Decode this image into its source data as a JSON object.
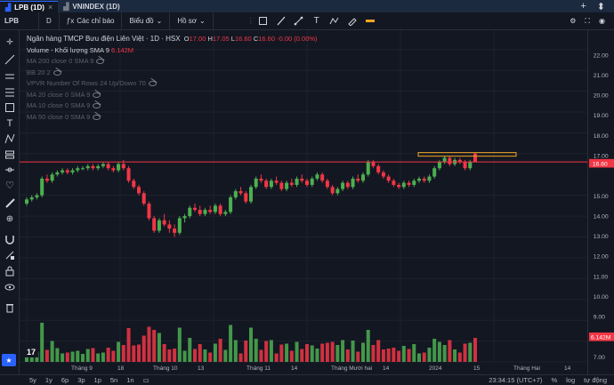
{
  "window_tabs": [
    {
      "label": "LPB (1D)",
      "active": true
    },
    {
      "label": "VNINDEX (1D)",
      "active": false
    }
  ],
  "toolbar": {
    "symbol": "LPB",
    "interval": "D",
    "indicators_label": "Các chỉ báo",
    "chart_type_label": "Biểu đồ",
    "profile_label": "Hồ sơ"
  },
  "legend": {
    "title": "Ngân hàng TMCP Bưu điện Liên Việt · 1D · HSX",
    "ohlc": [
      {
        "k": "O",
        "v": "17.00"
      },
      {
        "k": "H",
        "v": "17.05"
      },
      {
        "k": "L",
        "v": "16.60"
      },
      {
        "k": "C",
        "v": "16.60 -0.00 (0.00%)"
      }
    ],
    "volume_label": "Volume - Khối lượng SMA 9",
    "volume_value": "6.142M",
    "indicators": [
      "MA 200 close 0 SMA 9",
      "BB 20 2",
      "VPVR Number Of Rows 24 Up/Down 70",
      "MA 20 close 0 SMA 9",
      "MA 10 close 0 SMA 9",
      "MA 50 close 0 SMA 9"
    ]
  },
  "price_axis": {
    "ticks": [
      "22.00",
      "21.00",
      "20.00",
      "19.00",
      "18.00",
      "17.00",
      "15.00",
      "14.00",
      "13.00",
      "12.00",
      "11.00",
      "10.00",
      "9.00",
      "8.00",
      "7.00"
    ],
    "last_price_label": "16.60",
    "volume_label": "6.142M"
  },
  "time_axis": {
    "ticks": [
      "Tháng 9",
      "18",
      "Tháng 10",
      "13",
      "Tháng 11",
      "14",
      "Tháng Mười hai",
      "14",
      "2024",
      "15",
      "Tháng Hai",
      "14"
    ]
  },
  "bottombar": {
    "ranges": [
      "5y",
      "1y",
      "6p",
      "3p",
      "1p",
      "5n",
      "1n"
    ],
    "time": "23:34:15 (UTC+7)",
    "percent": "%",
    "log": "log",
    "auto": "tự động"
  },
  "colors": {
    "up": "#4caf50",
    "down": "#f23645",
    "accent": "#2962ff",
    "background": "#131722"
  },
  "chart_data": {
    "type": "candlestick",
    "ylim": [
      7,
      22.5
    ],
    "candles": [
      {
        "o": 14.6,
        "h": 14.9,
        "l": 14.5,
        "c": 14.8
      },
      {
        "o": 14.8,
        "h": 15.0,
        "l": 14.7,
        "c": 14.9
      },
      {
        "o": 14.9,
        "h": 15.1,
        "l": 14.8,
        "c": 15.0
      },
      {
        "o": 15.0,
        "h": 15.9,
        "l": 14.9,
        "c": 15.8
      },
      {
        "o": 15.8,
        "h": 16.0,
        "l": 15.6,
        "c": 15.7
      },
      {
        "o": 15.7,
        "h": 16.1,
        "l": 15.6,
        "c": 16.0
      },
      {
        "o": 16.0,
        "h": 16.2,
        "l": 15.9,
        "c": 16.1
      },
      {
        "o": 16.1,
        "h": 16.3,
        "l": 16.0,
        "c": 16.2
      },
      {
        "o": 16.2,
        "h": 16.3,
        "l": 16.0,
        "c": 16.1
      },
      {
        "o": 16.1,
        "h": 16.3,
        "l": 16.0,
        "c": 16.2
      },
      {
        "o": 16.2,
        "h": 16.4,
        "l": 16.1,
        "c": 16.3
      },
      {
        "o": 16.3,
        "h": 16.4,
        "l": 16.2,
        "c": 16.3
      },
      {
        "o": 16.3,
        "h": 16.5,
        "l": 16.2,
        "c": 16.4
      },
      {
        "o": 16.4,
        "h": 16.5,
        "l": 16.2,
        "c": 16.3
      },
      {
        "o": 16.3,
        "h": 16.5,
        "l": 16.2,
        "c": 16.4
      },
      {
        "o": 16.4,
        "h": 16.6,
        "l": 16.3,
        "c": 16.5
      },
      {
        "o": 16.5,
        "h": 16.6,
        "l": 16.2,
        "c": 16.3
      },
      {
        "o": 16.3,
        "h": 16.4,
        "l": 16.1,
        "c": 16.2
      },
      {
        "o": 16.2,
        "h": 16.6,
        "l": 16.1,
        "c": 16.5
      },
      {
        "o": 16.5,
        "h": 16.7,
        "l": 16.2,
        "c": 16.3
      },
      {
        "o": 16.3,
        "h": 16.4,
        "l": 15.6,
        "c": 15.7
      },
      {
        "o": 15.7,
        "h": 15.8,
        "l": 15.3,
        "c": 15.4
      },
      {
        "o": 15.4,
        "h": 15.5,
        "l": 15.0,
        "c": 15.1
      },
      {
        "o": 15.1,
        "h": 15.2,
        "l": 14.5,
        "c": 14.6
      },
      {
        "o": 14.6,
        "h": 14.7,
        "l": 13.8,
        "c": 13.9
      },
      {
        "o": 13.9,
        "h": 14.0,
        "l": 13.2,
        "c": 13.3
      },
      {
        "o": 13.3,
        "h": 13.9,
        "l": 13.2,
        "c": 13.8
      },
      {
        "o": 13.8,
        "h": 14.1,
        "l": 13.5,
        "c": 13.6
      },
      {
        "o": 13.6,
        "h": 13.8,
        "l": 13.2,
        "c": 13.4
      },
      {
        "o": 13.4,
        "h": 13.6,
        "l": 13.0,
        "c": 13.2
      },
      {
        "o": 13.2,
        "h": 14.0,
        "l": 13.1,
        "c": 13.9
      },
      {
        "o": 13.9,
        "h": 14.1,
        "l": 13.7,
        "c": 14.0
      },
      {
        "o": 14.0,
        "h": 14.5,
        "l": 13.9,
        "c": 14.4
      },
      {
        "o": 14.4,
        "h": 14.6,
        "l": 14.2,
        "c": 14.3
      },
      {
        "o": 14.3,
        "h": 14.5,
        "l": 14.0,
        "c": 14.1
      },
      {
        "o": 14.1,
        "h": 14.4,
        "l": 14.0,
        "c": 14.3
      },
      {
        "o": 14.3,
        "h": 14.5,
        "l": 14.1,
        "c": 14.2
      },
      {
        "o": 14.2,
        "h": 14.6,
        "l": 14.1,
        "c": 14.5
      },
      {
        "o": 14.5,
        "h": 14.6,
        "l": 14.0,
        "c": 14.1
      },
      {
        "o": 14.1,
        "h": 14.3,
        "l": 14.0,
        "c": 14.2
      },
      {
        "o": 14.2,
        "h": 15.0,
        "l": 14.1,
        "c": 14.9
      },
      {
        "o": 14.9,
        "h": 15.3,
        "l": 14.8,
        "c": 15.2
      },
      {
        "o": 15.2,
        "h": 15.4,
        "l": 15.0,
        "c": 15.1
      },
      {
        "o": 15.1,
        "h": 15.2,
        "l": 14.6,
        "c": 14.7
      },
      {
        "o": 14.7,
        "h": 15.5,
        "l": 14.6,
        "c": 15.4
      },
      {
        "o": 15.4,
        "h": 15.9,
        "l": 15.3,
        "c": 15.8
      },
      {
        "o": 15.8,
        "h": 16.0,
        "l": 15.6,
        "c": 15.7
      },
      {
        "o": 15.7,
        "h": 15.8,
        "l": 15.3,
        "c": 15.4
      },
      {
        "o": 15.4,
        "h": 15.8,
        "l": 15.3,
        "c": 15.7
      },
      {
        "o": 15.7,
        "h": 15.9,
        "l": 15.5,
        "c": 15.6
      },
      {
        "o": 15.6,
        "h": 15.7,
        "l": 15.2,
        "c": 15.3
      },
      {
        "o": 15.3,
        "h": 15.7,
        "l": 15.2,
        "c": 15.6
      },
      {
        "o": 15.6,
        "h": 15.8,
        "l": 15.4,
        "c": 15.5
      },
      {
        "o": 15.5,
        "h": 15.9,
        "l": 15.4,
        "c": 15.8
      },
      {
        "o": 15.8,
        "h": 16.0,
        "l": 15.6,
        "c": 15.7
      },
      {
        "o": 15.7,
        "h": 15.8,
        "l": 15.4,
        "c": 15.5
      },
      {
        "o": 15.5,
        "h": 15.9,
        "l": 15.4,
        "c": 15.8
      },
      {
        "o": 15.8,
        "h": 16.1,
        "l": 15.7,
        "c": 16.0
      },
      {
        "o": 16.0,
        "h": 16.1,
        "l": 15.6,
        "c": 15.7
      },
      {
        "o": 15.7,
        "h": 15.8,
        "l": 15.3,
        "c": 15.4
      },
      {
        "o": 15.4,
        "h": 15.5,
        "l": 15.0,
        "c": 15.1
      },
      {
        "o": 15.1,
        "h": 15.4,
        "l": 15.0,
        "c": 15.3
      },
      {
        "o": 15.3,
        "h": 15.7,
        "l": 15.2,
        "c": 15.6
      },
      {
        "o": 15.6,
        "h": 15.7,
        "l": 15.3,
        "c": 15.4
      },
      {
        "o": 15.4,
        "h": 15.9,
        "l": 15.3,
        "c": 15.8
      },
      {
        "o": 15.8,
        "h": 16.0,
        "l": 15.6,
        "c": 15.7
      },
      {
        "o": 15.7,
        "h": 16.1,
        "l": 15.6,
        "c": 16.0
      },
      {
        "o": 16.0,
        "h": 16.7,
        "l": 15.9,
        "c": 16.6
      },
      {
        "o": 16.6,
        "h": 16.7,
        "l": 16.3,
        "c": 16.4
      },
      {
        "o": 16.4,
        "h": 16.5,
        "l": 16.0,
        "c": 16.1
      },
      {
        "o": 16.1,
        "h": 16.2,
        "l": 15.8,
        "c": 15.9
      },
      {
        "o": 15.9,
        "h": 16.0,
        "l": 15.6,
        "c": 15.7
      },
      {
        "o": 15.7,
        "h": 15.8,
        "l": 15.4,
        "c": 15.5
      },
      {
        "o": 15.5,
        "h": 15.6,
        "l": 15.3,
        "c": 15.4
      },
      {
        "o": 15.4,
        "h": 15.7,
        "l": 15.3,
        "c": 15.6
      },
      {
        "o": 15.6,
        "h": 15.7,
        "l": 15.4,
        "c": 15.5
      },
      {
        "o": 15.5,
        "h": 15.8,
        "l": 15.4,
        "c": 15.7
      },
      {
        "o": 15.7,
        "h": 15.9,
        "l": 15.6,
        "c": 15.8
      },
      {
        "o": 15.8,
        "h": 15.9,
        "l": 15.6,
        "c": 15.7
      },
      {
        "o": 15.7,
        "h": 16.0,
        "l": 15.6,
        "c": 15.9
      },
      {
        "o": 15.9,
        "h": 16.4,
        "l": 15.8,
        "c": 16.3
      },
      {
        "o": 16.3,
        "h": 16.7,
        "l": 16.2,
        "c": 16.6
      },
      {
        "o": 16.6,
        "h": 16.9,
        "l": 16.5,
        "c": 16.8
      },
      {
        "o": 16.8,
        "h": 16.9,
        "l": 16.4,
        "c": 16.5
      },
      {
        "o": 16.5,
        "h": 16.8,
        "l": 16.4,
        "c": 16.7
      },
      {
        "o": 16.7,
        "h": 16.8,
        "l": 16.5,
        "c": 16.6
      },
      {
        "o": 16.6,
        "h": 16.7,
        "l": 16.2,
        "c": 16.3
      },
      {
        "o": 16.3,
        "h": 16.7,
        "l": 16.2,
        "c": 16.6
      },
      {
        "o": 17.0,
        "h": 17.05,
        "l": 16.6,
        "c": 16.6
      }
    ],
    "volume_ylim": [
      0,
      18
    ]
  }
}
